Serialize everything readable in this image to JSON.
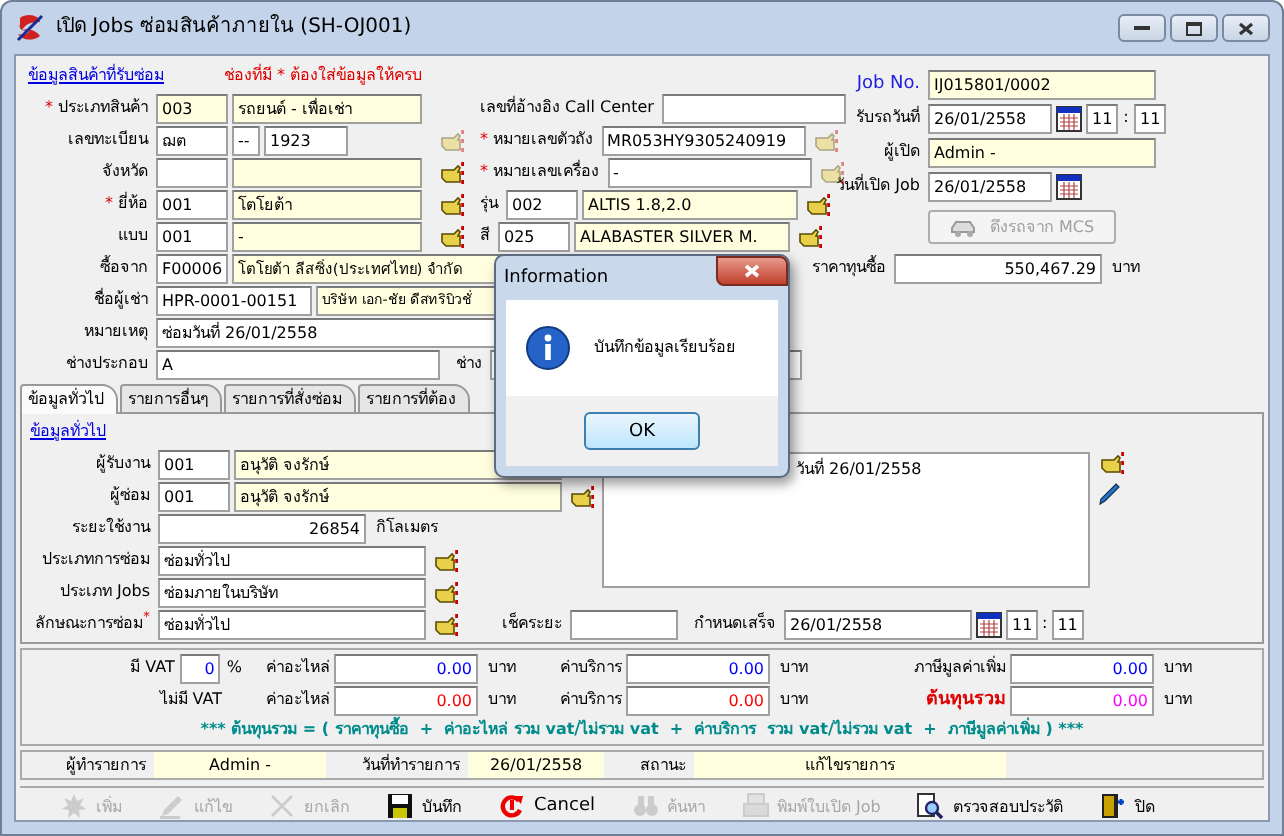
{
  "window": {
    "title": "เปิด Jobs ซ่อมสินค้าภายใน (SH-OJ001)"
  },
  "item_info": {
    "heading": "ข้อมูลสินค้าที่รับซ่อม",
    "note": "ช่องที่มี * ต้องใส่ข้อมูลให้ครบ",
    "rows": [
      {
        "mark": "*",
        "label": "ประเภทสินค้า",
        "fields": [
          {
            "value": "003",
            "kind": "code",
            "readonly": true
          },
          {
            "value": "รถยนต์ - เพื่อเช่า",
            "kind": "name",
            "readonly": true
          }
        ],
        "side": {
          "label": "เลขที่อ้างอิง Call Center",
          "fields": [
            {
              "kind": "call",
              "readonly": false
            }
          ]
        }
      },
      {
        "label": "เลขทะเบียน",
        "fields": [
          {
            "value": "ฌต",
            "kind": "code",
            "readonly": false
          },
          {
            "value": "--",
            "kind": "dash",
            "readonly": false
          },
          {
            "value": "1923",
            "kind": "short",
            "readonly": false
          }
        ],
        "picker": {
          "disabled": true
        },
        "side": {
          "mark": "*",
          "label": "หมายเลขตัวถัง",
          "fields": [
            {
              "value": "MR053HY9305240919",
              "kind": "chassis",
              "readonly": false
            }
          ],
          "picker": {
            "disabled": true
          }
        }
      },
      {
        "label": "จังหวัด",
        "fields": [
          {
            "kind": "code",
            "readonly": false
          },
          {
            "kind": "name",
            "readonly": true
          }
        ],
        "picker": {
          "disabled": false
        },
        "side": {
          "mark": "*",
          "label": "หมายเลขเครื่อง",
          "fields": [
            {
              "value": "-",
              "kind": "chassis",
              "readonly": false
            }
          ],
          "picker": {
            "disabled": true
          }
        }
      },
      {
        "mark": "*",
        "label": "ยี่ห้อ",
        "fields": [
          {
            "value": "001",
            "kind": "code",
            "readonly": false
          },
          {
            "value": "โตโยต้า",
            "kind": "name",
            "readonly": true
          }
        ],
        "picker": {
          "disabled": false
        },
        "side": {
          "label": "รุ่น",
          "fields": [
            {
              "value": "002",
              "kind": "code",
              "readonly": false
            },
            {
              "value": "ALTIS 1.8,2.0",
              "kind": "model",
              "readonly": true
            }
          ],
          "picker": {
            "disabled": false
          }
        }
      },
      {
        "label": "แบบ",
        "fields": [
          {
            "value": "001",
            "kind": "code",
            "readonly": false
          },
          {
            "value": "-",
            "kind": "name",
            "readonly": true
          }
        ],
        "picker": {
          "disabled": false
        },
        "side": {
          "label": "สี",
          "fields": [
            {
              "value": "025",
              "kind": "code",
              "readonly": false
            },
            {
              "value": "ALABASTER SILVER M.",
              "kind": "model",
              "readonly": true
            }
          ],
          "picker": {
            "disabled": false
          }
        }
      }
    ],
    "wide_rows": [
      {
        "label": "ซื้อจาก",
        "fields": [
          {
            "value": "F00006",
            "kind": "code",
            "readonly": false
          },
          {
            "value": "โตโยต้า ลีสซิ่ง(ประเทศไทย) จำกัด",
            "kind": "company",
            "readonly": true
          }
        ],
        "side": {
          "label": "ราคาทุนซื้อ",
          "fields": [
            {
              "value": "550,467.29",
              "kind": "price",
              "readonly": false
            }
          ],
          "unit": "บาท"
        }
      },
      {
        "label": "ชื่อผู้เช่า",
        "fields": [
          {
            "value": "HPR-0001-00151",
            "kind": "renter",
            "readonly": false
          },
          {
            "value": "บริษัท เอก-ชัย ดีสทริบิวชั่",
            "kind": "renter_name",
            "readonly": true
          }
        ]
      },
      {
        "label": "หมายเหตุ",
        "fields": [
          {
            "value": "ซ่อมวันที่ 26/01/2558",
            "kind": "remark",
            "readonly": false
          }
        ]
      },
      {
        "label": "ช่างประกอบ",
        "fields": [
          {
            "value": "A",
            "kind": "mechanic",
            "readonly": false
          }
        ],
        "side": {
          "label": "ช่าง",
          "fields": [
            {
              "kind": "hidden_mech"
            }
          ]
        }
      }
    ]
  },
  "job": {
    "rows": [
      {
        "label": "Job No.",
        "kind": "text",
        "field": {
          "value": "IJ015801/0002",
          "readonly": true
        }
      },
      {
        "label": "รับรถวันที่",
        "kind": "date",
        "field": {
          "value": "26/01/2558",
          "readonly": false
        },
        "time": {
          "hour": "11",
          "sep": ":",
          "minute": "11"
        }
      },
      {
        "label": "ผู้เปิด",
        "kind": "text",
        "field": {
          "value": "Admin -",
          "readonly": true
        }
      },
      {
        "label": "วันที่เปิด Job",
        "kind": "date",
        "field": {
          "value": "26/01/2558",
          "readonly": false
        }
      }
    ],
    "mcs_button": {
      "label": "ดึงรถจาก MCS",
      "disabled": true
    }
  },
  "tabs": [
    {
      "label": "ข้อมูลทั่วไป",
      "selected": true
    },
    {
      "label": "รายการอื่นๆ",
      "selected": false
    },
    {
      "label": "รายการที่สั่งซ่อม",
      "selected": false
    },
    {
      "label": "รายการที่ต้อง",
      "selected": false
    }
  ],
  "general": {
    "heading": "ข้อมูลทั่วไป",
    "rows": [
      {
        "label": "ผู้รับงาน",
        "fields": [
          {
            "value": "001",
            "kind": "code",
            "readonly": false
          },
          {
            "value": "อนุวัติ จงรักษ์",
            "kind": "person",
            "readonly": true
          }
        ]
      },
      {
        "label": "ผู้ซ่อม",
        "fields": [
          {
            "value": "001",
            "kind": "code",
            "readonly": false
          },
          {
            "value": "อนุวัติ จงรักษ์",
            "kind": "person",
            "readonly": true
          }
        ],
        "picker": {
          "disabled": false
        }
      },
      {
        "label": "ระยะใช้งาน",
        "fields": [
          {
            "value": "26854",
            "kind": "distance",
            "readonly": false
          }
        ],
        "unit": "กิโลเมตร"
      },
      {
        "label": "ประเภทการซ่อม",
        "fields": [
          {
            "value": "ซ่อมทั่วไป",
            "kind": "type",
            "readonly": false
          }
        ],
        "picker": {
          "disabled": false
        }
      },
      {
        "label": "ประเภท Jobs",
        "fields": [
          {
            "value": "ซ่อมภายในบริษัท",
            "kind": "type",
            "readonly": false
          }
        ],
        "picker": {
          "disabled": false
        }
      }
    ],
    "notes": "วันที่ 26/01/2558",
    "last_row": {
      "label": "ลักษณะการซ่อม$^{*}$",
      "fields": [
        {
          "value": "ซ่อมทั่วไป",
          "kind": "type",
          "readonly": false
        }
      ],
      "picker": {
        "disabled": false
      },
      "check_label": "เช็คระยะ",
      "due_label": "กำหนดเสร็จ",
      "due_date": "26/01/2558",
      "due_time": {
        "hour": "11",
        "sep": ":",
        "minute": "11"
      }
    }
  },
  "costs": {
    "rows": [
      {
        "label": "มี VAT",
        "vat": "0",
        "vat_unit": "%",
        "color": "#0000ff",
        "parts_label": "ค่าอะไหล่",
        "parts": {
          "value": "0.00",
          "color": "#0000ff"
        },
        "unit1": "บาท",
        "service_label": "ค่าบริการ",
        "service": {
          "value": "0.00",
          "color": "#0000ff"
        },
        "unit2": "บาท",
        "extra_label": {
          "text": "ภาษีมูลค่าเพิ่ม",
          "emphasis": false
        },
        "extra": {
          "value": "0.00",
          "color": "#0000ff"
        },
        "unit3": "บาท"
      },
      {
        "label": "ไม่มี VAT",
        "parts_label": "ค่าอะไหล่",
        "parts": {
          "value": "0.00",
          "color": "#ff0000"
        },
        "unit1": "บาท",
        "service_label": "ค่าบริการ",
        "service": {
          "value": "0.00",
          "color": "#ff0000"
        },
        "unit2": "บาท",
        "extra_label": {
          "text": "ต้นทุนรวม",
          "emphasis": true
        },
        "extra": {
          "value": "0.00",
          "color": "#ff00ff"
        },
        "unit3": "บาท"
      }
    ],
    "formula": "*** ต้นทุนรวม = ( ราคาทุนซื้อ  +  ค่าอะไหล่ รวม vat/ไม่รวม vat  +  ค่าบริการ  รวม vat/ไม่รวม vat  +  ภาษีมูลค่าเพิ่ม ) ***"
  },
  "status_bar": [
    {
      "label": "ผู้ทำรายการ",
      "value": "Admin -"
    },
    {
      "label": "วันที่ทำรายการ",
      "value": "26/01/2558"
    },
    {
      "label": "สถานะ",
      "value": "แก้ไขรายการ"
    }
  ],
  "toolbar": [
    {
      "kind": "add",
      "label": "เพิ่ม",
      "disabled": true
    },
    {
      "kind": "edit",
      "label": "แก้ไข",
      "disabled": true
    },
    {
      "kind": "discard",
      "label": "ยกเลิก",
      "disabled": true
    },
    {
      "kind": "save",
      "label": "บันทึก",
      "disabled": false
    },
    {
      "kind": "cancel",
      "label": "Cancel",
      "disabled": false
    },
    {
      "kind": "find",
      "label": "ค้นหา",
      "disabled": true
    },
    {
      "kind": "print",
      "label": "พิมพ์ใบเปิด Job",
      "disabled": true
    },
    {
      "kind": "history",
      "label": "ตรวจสอบประวัติ",
      "disabled": false
    },
    {
      "kind": "exit",
      "label": "ปิด",
      "disabled": false
    }
  ],
  "dialog": {
    "title": "Information",
    "message": "บันทึกข้อมูลเรียบร้อย",
    "button": "OK"
  }
}
